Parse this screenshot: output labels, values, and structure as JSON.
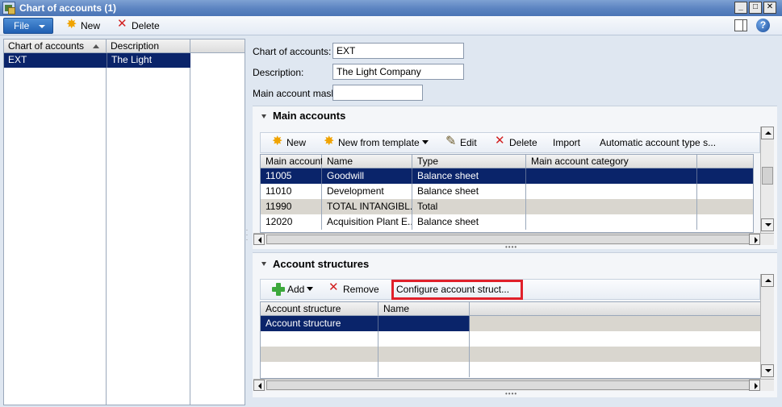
{
  "window": {
    "title": "Chart of accounts (1)"
  },
  "toolbar": {
    "file_label": "File",
    "new_label": "New",
    "delete_label": "Delete"
  },
  "list": {
    "headers": [
      "Chart of accounts",
      "Description"
    ],
    "rows": [
      {
        "chart": "EXT",
        "description": "The Light Company"
      }
    ]
  },
  "fields": {
    "chart_label": "Chart of accounts:",
    "chart_value": "EXT",
    "description_label": "Description:",
    "description_value": "The Light Company",
    "mask_label": "Main account mask:",
    "mask_value": ""
  },
  "main_accounts": {
    "title": "Main accounts",
    "buttons": {
      "new": "New",
      "new_from_template": "New from template",
      "edit": "Edit",
      "delete": "Delete",
      "import": "Import",
      "auto_type": "Automatic account type s..."
    },
    "headers": [
      "Main account",
      "Name",
      "Type",
      "Main account category"
    ],
    "rows": [
      {
        "account": "11005",
        "name": "Goodwill",
        "type": "Balance sheet",
        "category": ""
      },
      {
        "account": "11010",
        "name": "Development",
        "type": "Balance sheet",
        "category": ""
      },
      {
        "account": "11990",
        "name": "TOTAL INTANGIBL...",
        "type": "Total",
        "category": ""
      },
      {
        "account": "12020",
        "name": "Acquisition Plant E...",
        "type": "Balance sheet",
        "category": ""
      }
    ]
  },
  "account_structures": {
    "title": "Account structures",
    "buttons": {
      "add": "Add",
      "remove": "Remove",
      "configure": "Configure account struct..."
    },
    "headers": [
      "Account structure",
      "Name"
    ],
    "rows": [
      {
        "structure": "Account structure",
        "name": ""
      }
    ]
  },
  "colors": {
    "selection": "#0a246a",
    "highlight": "#e0202a",
    "title_bar": "#5d85c2"
  }
}
